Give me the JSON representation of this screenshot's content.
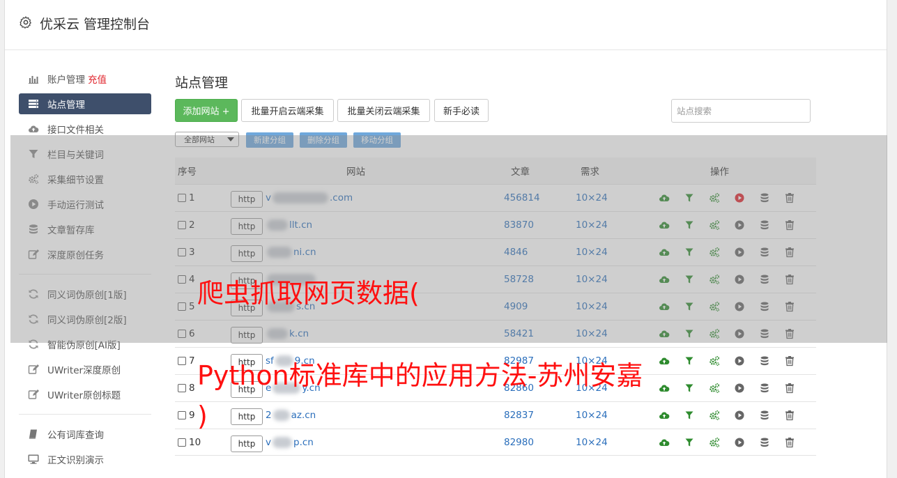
{
  "app": {
    "title": "优采云 管理控制台"
  },
  "sidebar": {
    "group1": [
      {
        "label": "账户管理",
        "extra": "充值",
        "icon": "bar-chart-icon"
      },
      {
        "label": "站点管理",
        "icon": "server-list-icon",
        "active": true
      },
      {
        "label": "接口文件相关",
        "icon": "cloud-upload-icon"
      },
      {
        "label": "栏目与关键词",
        "icon": "filter-icon"
      },
      {
        "label": "采集细节设置",
        "icon": "cogs-icon"
      },
      {
        "label": "手动运行测试",
        "icon": "play-circle-icon"
      },
      {
        "label": "文章暂存库",
        "icon": "database-icon"
      },
      {
        "label": "深度原创任务",
        "icon": "edit-icon"
      }
    ],
    "group2": [
      {
        "label": "同义词伪原创[1版]",
        "icon": "refresh-icon"
      },
      {
        "label": "同义词伪原创[2版]",
        "icon": "refresh-icon"
      },
      {
        "label": "智能伪原创[AI版]",
        "icon": "refresh-icon"
      },
      {
        "label": "UWriter深度原创",
        "icon": "edit-icon"
      },
      {
        "label": "UWriter原创标题",
        "icon": "edit-icon"
      }
    ],
    "group3": [
      {
        "label": "公有词库查询",
        "icon": "book-icon"
      },
      {
        "label": "正文识别演示",
        "icon": "monitor-icon"
      }
    ]
  },
  "main": {
    "title": "站点管理",
    "buttons": {
      "add": "添加网站 +",
      "enable_cloud": "批量开启云端采集",
      "disable_cloud": "批量关闭云端采集",
      "guide": "新手必读"
    },
    "search_placeholder": "站点搜索",
    "group_select": "全部网站",
    "group_buttons": {
      "new": "新建分组",
      "delete": "删除分组",
      "move": "移动分组"
    },
    "table": {
      "headers": {
        "index": "序号",
        "site": "网站",
        "articles": "文章",
        "demand": "需求",
        "ops": "操作"
      },
      "rows": [
        {
          "index": "1",
          "protocol": "http",
          "pre": "v",
          "post": ".com",
          "articles": "456814",
          "demand": "10×24",
          "run_color": "#e0242c"
        },
        {
          "index": "2",
          "protocol": "http",
          "pre": "",
          "post": "llt.cn",
          "articles": "83870",
          "demand": "10×24",
          "run_color": "#666"
        },
        {
          "index": "3",
          "protocol": "http",
          "pre": "",
          "post": "ni.cn",
          "articles": "4846",
          "demand": "10×24",
          "run_color": "#666"
        },
        {
          "index": "4",
          "protocol": "http",
          "pre": "",
          "post": "",
          "articles": "58728",
          "demand": "10×24",
          "run_color": "#666"
        },
        {
          "index": "5",
          "protocol": "http",
          "pre": "",
          "post": "s.cn",
          "articles": "4909",
          "demand": "10×24",
          "run_color": "#666"
        },
        {
          "index": "6",
          "protocol": "http",
          "pre": "",
          "post": "k.cn",
          "articles": "58421",
          "demand": "10×24",
          "run_color": "#666"
        },
        {
          "index": "7",
          "protocol": "http",
          "pre": "sf",
          "post": "9.cn",
          "articles": "82987",
          "demand": "10×24",
          "run_color": "#666"
        },
        {
          "index": "8",
          "protocol": "http",
          "pre": "e",
          "post": "y.cn",
          "articles": "82860",
          "demand": "10×24",
          "run_color": "#666"
        },
        {
          "index": "9",
          "protocol": "http",
          "pre": "2",
          "post": "az.cn",
          "articles": "82837",
          "demand": "10×24",
          "run_color": "#666"
        },
        {
          "index": "10",
          "protocol": "http",
          "pre": "v",
          "post": "p.cn",
          "articles": "82980",
          "demand": "10×24",
          "run_color": "#666"
        }
      ]
    }
  },
  "watermark": {
    "line1": "爬虫抓取网页数据(",
    "line2": "Python标准库中的应用方法-苏州安嘉",
    "line3": ")"
  },
  "colors": {
    "accent": "#3e4f6b",
    "green": "#5cb85c",
    "link": "#2a6ebb",
    "group_btn": "#6fa8dc",
    "watermark": "#ff1010"
  }
}
